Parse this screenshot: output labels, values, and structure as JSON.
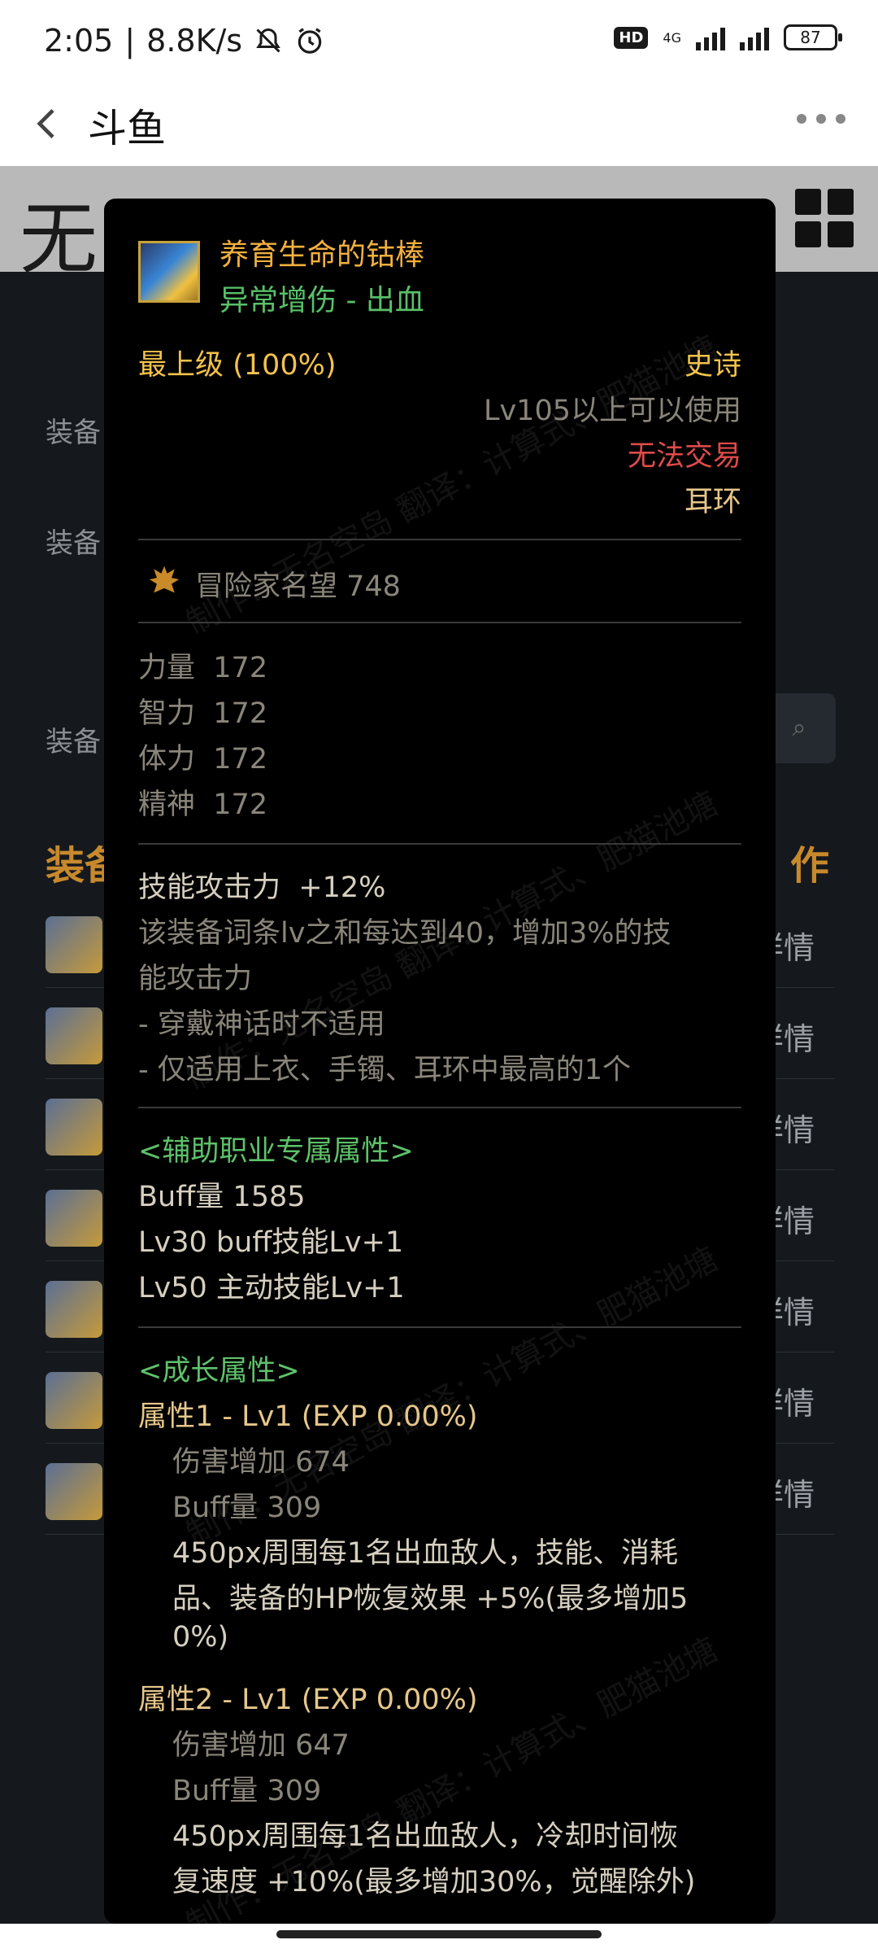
{
  "status_bar": {
    "time": "2:05",
    "speed": "8.8K/s",
    "hd": "HD",
    "net": "4G",
    "battery": "87"
  },
  "header": {
    "title": "斗鱼"
  },
  "background_page": {
    "logo_text": "无名空岛",
    "labels": [
      "装备",
      "装备",
      "装备"
    ],
    "section_left": "装备",
    "section_right": "作",
    "row_detail": "详情"
  },
  "tooltip": {
    "item_name": "养育生命的钴棒",
    "item_subtitle": "异常增伤 - 出血",
    "grade": "最上级 (100%)",
    "rarity": "史诗",
    "level_req": "Lv105以上可以使用",
    "trade": "无法交易",
    "slot": "耳环",
    "fame": "冒险家名望 748",
    "stats": [
      {
        "label": "力量",
        "value": "172"
      },
      {
        "label": "智力",
        "value": "172"
      },
      {
        "label": "体力",
        "value": "172"
      },
      {
        "label": "精神",
        "value": "172"
      }
    ],
    "skill_atk": {
      "label": "技能攻击力",
      "value": "+12%"
    },
    "skill_desc": [
      "该装备词条lv之和每达到40，增加3%的技",
      "能攻击力",
      "- 穿戴神话时不适用",
      "- 仅适用上衣、手镯、耳环中最高的1个"
    ],
    "support_header": "<辅助职业专属属性>",
    "support_lines": [
      "Buff量   1585",
      "Lv30 buff技能Lv+1",
      "Lv50 主动技能Lv+1"
    ],
    "growth_header": "<成长属性>",
    "attr1": {
      "title": "属性1 - Lv1 (EXP 0.00%)",
      "dmg": "伤害增加   674",
      "buff": "Buff量   309",
      "desc": [
        "450px周围每1名出血敌人，技能、消耗",
        "品、装备的HP恢复效果 +5%(最多增加5",
        "0%)"
      ]
    },
    "attr2": {
      "title": "属性2 - Lv1 (EXP 0.00%)",
      "dmg": "伤害增加   647",
      "buff": "Buff量   309",
      "desc": [
        "450px周围每1名出血敌人，冷却时间恢",
        "复速度 +10%(最多增加30%，觉醒除外)"
      ]
    },
    "watermark": "制作：无名空岛 翻译：计算式、肥猫池塘"
  }
}
